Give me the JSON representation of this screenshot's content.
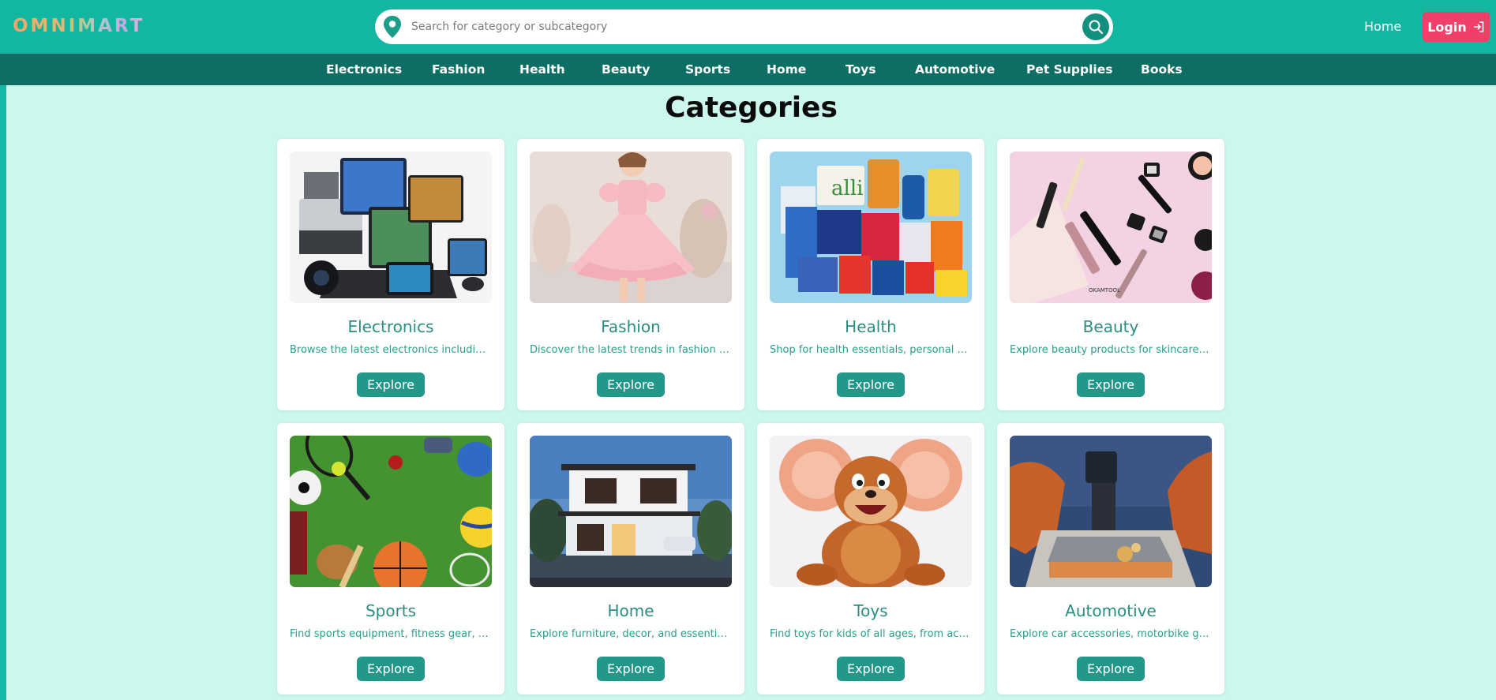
{
  "header": {
    "logo": "OMNIMART",
    "search_placeholder": "Search for category or subcategory",
    "home_link": "Home",
    "login_label": "Login"
  },
  "nav": {
    "items": [
      "Electronics",
      "Fashion",
      "Health",
      "Beauty",
      "Sports",
      "Home",
      "Toys",
      "Automotive",
      "Pet Supplies",
      "Books"
    ]
  },
  "main": {
    "title": "Categories",
    "explore_label": "Explore",
    "cards": [
      {
        "title": "Electronics",
        "desc": "Browse the latest electronics including gadgets and devices"
      },
      {
        "title": "Fashion",
        "desc": "Discover the latest trends in fashion for everyone"
      },
      {
        "title": "Health",
        "desc": "Shop for health essentials, personal care and wellness"
      },
      {
        "title": "Beauty",
        "desc": "Explore beauty products for skincare, haircare and makeup"
      },
      {
        "title": "Sports",
        "desc": "Find sports equipment, fitness gear, and outdoor essentials"
      },
      {
        "title": "Home",
        "desc": "Explore furniture, decor, and essentials for your home"
      },
      {
        "title": "Toys",
        "desc": "Find toys for kids of all ages, from action figures to plush"
      },
      {
        "title": "Automotive",
        "desc": "Explore car accessories, motorbike gear and tools"
      }
    ]
  },
  "colors": {
    "header_bg": "#13b6a0",
    "nav_bg": "#0f6e63",
    "main_bg": "#cbf7ed",
    "accent": "#22988a",
    "login_bg": "#f0406a"
  },
  "icons": {
    "pin": "location-pin-icon",
    "search": "search-icon",
    "login": "login-arrow-icon"
  }
}
